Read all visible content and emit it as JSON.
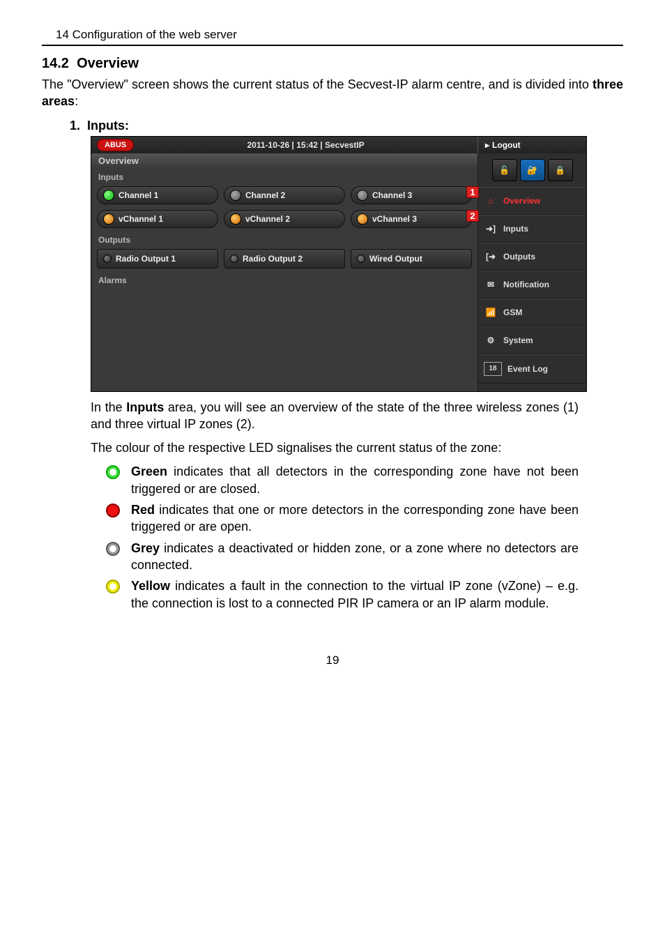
{
  "doc": {
    "header": "14  Configuration of the web server",
    "section_num": "14.2",
    "section_title": "Overview",
    "intro_a": "The \"Overview\" screen shows the current status of the Secvest-IP alarm centre, and is divided into ",
    "intro_b_bold": "three areas",
    "intro_c": ":",
    "list1_num": "1.",
    "list1_label": "Inputs:",
    "below1a": "In the ",
    "below1b_bold": "Inputs",
    "below1c": " area, you will see an overview of the state of the three wireless zones (1) and three virtual IP zones (2).",
    "below2": "The colour of the respective LED signalises the current status of the zone:",
    "legend": {
      "green_b": "Green",
      "green_t": " indicates that all detectors in the corresponding zone have not been triggered or are closed.",
      "red_b": "Red",
      "red_t": " indicates that one or more detectors in the corresponding zone have been triggered or are open.",
      "grey_b": "Grey",
      "grey_t": " indicates a deactivated or hidden zone, or a zone where no detectors are connected.",
      "yellow_b": "Yellow",
      "yellow_t": " indicates a fault in the connection to the virtual IP zone (vZone) – e.g. the connection is lost to a connected PIR IP camera or an IP alarm module."
    },
    "page": "19"
  },
  "ui": {
    "logo": "ABUS",
    "datetime": "2011-10-26  |  15:42  |  SecvestIP",
    "logout": "Logout",
    "overview": "Overview",
    "inputs_title": "Inputs",
    "outputs_title": "Outputs",
    "alarms_title": "Alarms",
    "ch1": "Channel 1",
    "ch2": "Channel 2",
    "ch3": "Channel 3",
    "vch1": "vChannel 1",
    "vch2": "vChannel 2",
    "vch3": "vChannel 3",
    "ro1": "Radio Output 1",
    "ro2": "Radio Output 2",
    "wo": "Wired Output",
    "callout1": "1",
    "callout2": "2",
    "nav": {
      "overview": "Overview",
      "inputs": "Inputs",
      "outputs": "Outputs",
      "notification": "Notification",
      "gsm": "GSM",
      "system": "System",
      "eventlog": "Event Log"
    }
  }
}
